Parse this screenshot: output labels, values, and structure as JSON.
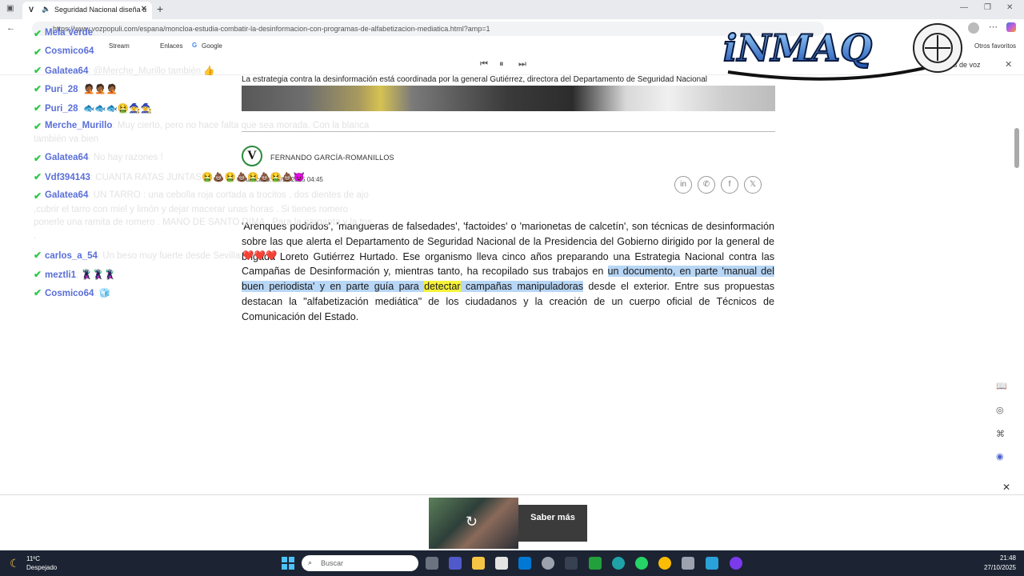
{
  "browser": {
    "tab_title": "Seguridad Nacional diseña u",
    "url": "https://www.vozpopuli.com/espana/moncloa-estudia-combatir-la-desinformacion-con-programas-de-alfabetizacion-mediatica.html?amp=1",
    "bookmarks": [
      "Stream",
      "Enlaces",
      "Google"
    ],
    "other_favorites": "Otros favoritos",
    "read_aloud": "ctes de voz"
  },
  "chat": [
    {
      "user": "Mela Verde",
      "msg": ":"
    },
    {
      "user": "Cosmico64",
      "msg": ":"
    },
    {
      "user": "Galatea64",
      "msg": ": @Merche_Murillo también 👍"
    },
    {
      "user": "Puri_28",
      "msg": ": 🤦🏾🤦🏾🤦🏾"
    },
    {
      "user": "Puri_28",
      "msg": ": 🐟🐟🐟🤮🧙🧙"
    },
    {
      "user": "Merche_Murillo",
      "msg": ": Muy cierto, pero no hace falta que sea morada. Con la blanca"
    },
    {
      "user": "",
      "msg": "también va bien"
    },
    {
      "user": "Galatea64",
      "msg": ": No hay razones !"
    },
    {
      "user": "Vdf394143",
      "msg": ": CUANTA RATAS JUNTAS🤮💩🤮💩🤮💩🤮💩😈"
    },
    {
      "user": "Galatea64",
      "msg": ": UN TARRO : una cebolla roja cortada a trocitos , dos dientes de ajo"
    },
    {
      "user": "",
      "msg": ",cubrir el tarro con miel y limón y dejar macerar unas horas . Si tienes romero"
    },
    {
      "user": "",
      "msg": "ponerle una ramita de romero . MANO DE SANTO DIMA . Para la garganta y la tos"
    },
    {
      "user": "",
      "msg": "."
    },
    {
      "user": "carlos_a_54",
      "msg": ": Un beso muy fuerte desde Sevilla ❤️❤️❤️"
    },
    {
      "user": "meztli1",
      "msg": ": 🦹🦹🦹"
    },
    {
      "user": "Cosmico64",
      "msg": ": 🧊"
    }
  ],
  "article": {
    "caption": "La estrategia contra la desinformación está coordinada por la general Gutiérrez, directora del Departamento de Seguridad Nacional",
    "author_logo": "V",
    "author": "FERNANDO GARCÍA-ROMANILLOS",
    "published": "Publicado: 25/10/2025 04:45",
    "share_icons": [
      "linkedin-icon",
      "whatsapp-icon",
      "facebook-icon",
      "x-icon"
    ],
    "body_1": "'Arenques podridos', 'mangueras de falsedades', 'factoides' o 'marionetas de calcetín', son técnicas de desinformación sobre las que alerta el Departamento de Seguridad Nacional de la Presidencia del Gobierno dirigido por la general de brigada Loreto Gutiérrez Hurtado. Ese organismo lleva cinco años preparando una Estrategia Nacional contra las Campañas de Desinformación y, mientras tanto, ha recopilado sus trabajos en ",
    "body_hl_1": "un documento, en parte 'manual del buen periodista' y en parte guía para ",
    "body_hl_word": "detectar",
    "body_hl_2": " campañas manipuladoras",
    "body_2": " desde el exterior. Entre sus propuestas destacan la \"alfabetización mediática\" de los ciudadanos y la creación de un cuerpo oficial de Técnicos de Comunicación del Estado."
  },
  "ad": {
    "button": "Saber más"
  },
  "taskbar": {
    "weather_temp": "11ºC",
    "weather_desc": "Despejado",
    "search_placeholder": "Buscar",
    "time": "21:48",
    "date": "27/10/2025"
  }
}
